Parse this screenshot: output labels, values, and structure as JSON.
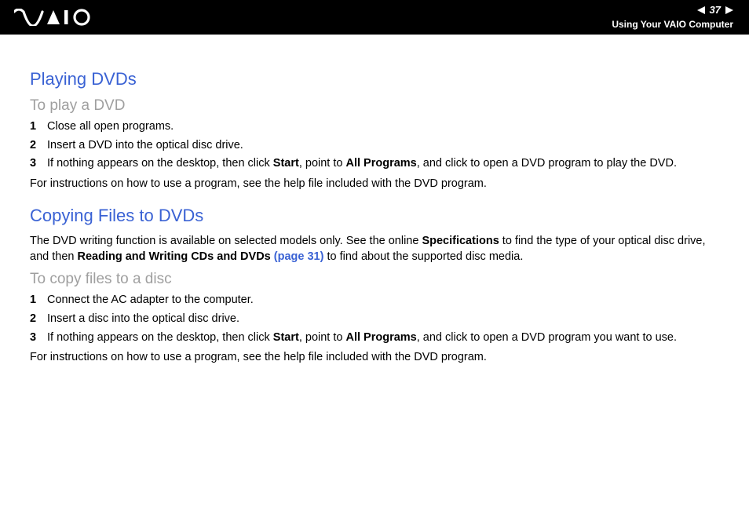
{
  "header": {
    "page_number": "37",
    "section_label": "Using Your VAIO Computer"
  },
  "section1": {
    "title": "Playing DVDs",
    "subtitle": "To play a DVD",
    "steps": [
      {
        "num": "1",
        "text": "Close all open programs."
      },
      {
        "num": "2",
        "text": "Insert a DVD into the optical disc drive."
      },
      {
        "num": "3",
        "pre": "If nothing appears on the desktop, then click ",
        "b1": "Start",
        "mid1": ", point to ",
        "b2": "All Programs",
        "post": ", and click to open a DVD program to play the DVD."
      }
    ],
    "footnote": "For instructions on how to use a program, see the help file included with the DVD program."
  },
  "section2": {
    "title": "Copying Files to DVDs",
    "intro_pre": "The DVD writing function is available on selected models only. See the online ",
    "intro_b1": "Specifications",
    "intro_mid1": " to find the type of your optical disc drive, and then ",
    "intro_b2": "Reading and Writing CDs and DVDs",
    "intro_link": " (page 31)",
    "intro_post": " to find about the supported disc media.",
    "subtitle": "To copy files to a disc",
    "steps": [
      {
        "num": "1",
        "text": "Connect the AC adapter to the computer."
      },
      {
        "num": "2",
        "text": "Insert a disc into the optical disc drive."
      },
      {
        "num": "3",
        "pre": "If nothing appears on the desktop, then click ",
        "b1": "Start",
        "mid1": ", point to ",
        "b2": "All Programs",
        "post": ", and click to open a DVD program you want to use."
      }
    ],
    "footnote": "For instructions on how to use a program, see the help file included with the DVD program."
  }
}
